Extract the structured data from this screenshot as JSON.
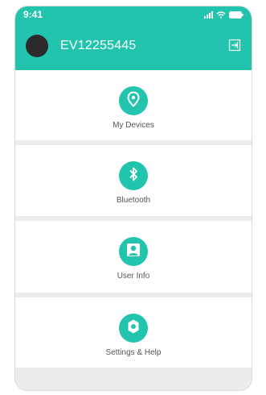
{
  "status_bar": {
    "time": "9:41",
    "icons": [
      "signal-icon",
      "wifi-icon",
      "battery-icon"
    ]
  },
  "header": {
    "device_id": "EV12255445",
    "logout_icon": "logout-icon",
    "color": "#22c4ad"
  },
  "menu": {
    "items": [
      {
        "label": "My Devices",
        "icon": "location-pin-icon"
      },
      {
        "label": "Bluetooth",
        "icon": "bluetooth-icon"
      },
      {
        "label": "User Info",
        "icon": "user-icon"
      },
      {
        "label": "Settings & Help",
        "icon": "gear-icon"
      }
    ]
  },
  "colors": {
    "accent": "#22c4ad",
    "background": "#ececec",
    "card": "#ffffff",
    "avatar": "#2b2b2b"
  }
}
